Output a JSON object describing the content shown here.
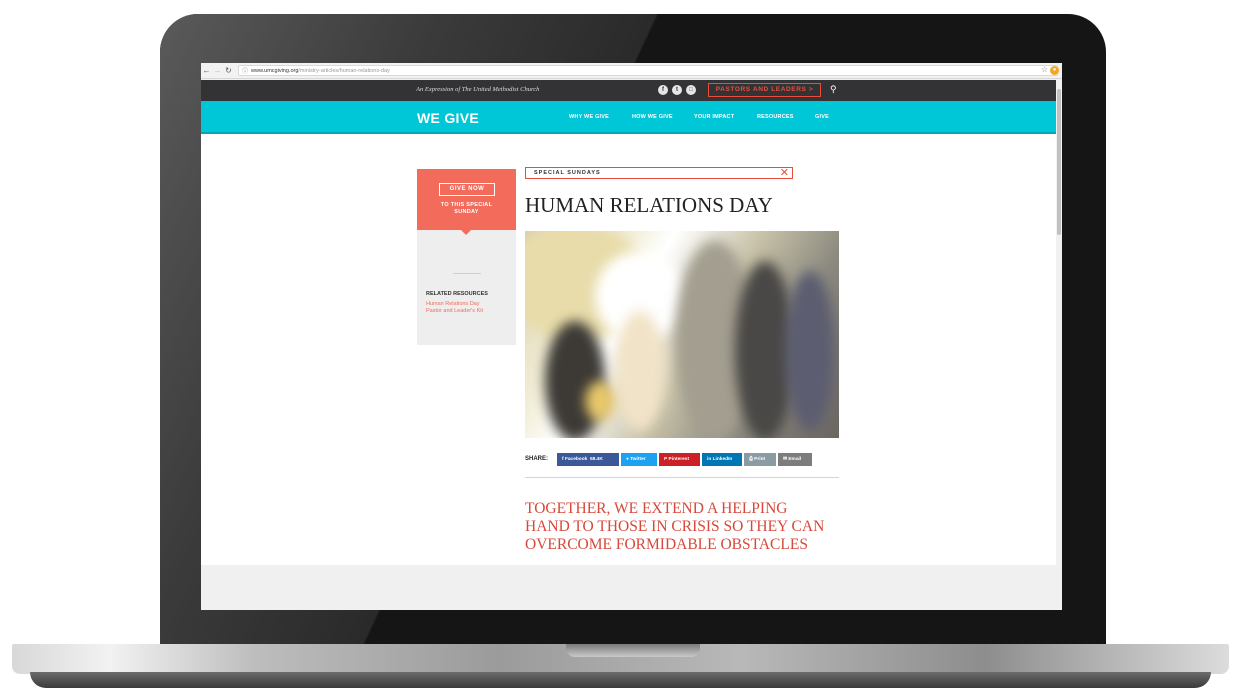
{
  "browser": {
    "url_host": "www.umcgiving.org",
    "url_path": "/ministry-articles/human-relations-day"
  },
  "topbar": {
    "tagline": "An Expression of The United Methodist Church",
    "pastors_button": "PASTORS AND LEADERS >",
    "social_icons": [
      "facebook-icon",
      "twitter-icon",
      "instagram-icon"
    ]
  },
  "nav": {
    "logo": "WE GIVE",
    "items": [
      "WHY WE GIVE",
      "HOW WE GIVE",
      "YOUR IMPACT",
      "RESOURCES",
      "GIVE"
    ]
  },
  "sidebar": {
    "give_now": "GIVE NOW",
    "give_sub_line1": "TO THIS SPECIAL",
    "give_sub_line2": "SUNDAY",
    "related_title": "RELATED RESOURCES",
    "related_link_line1": "Human Relations Day",
    "related_link_line2": "Pastor and Leader's Kit"
  },
  "article": {
    "category": "SPECIAL SUNDAYS",
    "title": "HUMAN RELATIONS DAY",
    "share_label": "SHARE:",
    "share_buttons": [
      {
        "label": "Facebook",
        "count": "58.4K",
        "color": "#3b5998"
      },
      {
        "label": "Twitter",
        "color": "#1da1f2"
      },
      {
        "label": "Pinterest",
        "color": "#cb2027"
      },
      {
        "label": "LinkedIn",
        "color": "#0077b5"
      },
      {
        "label": "Print",
        "color": "#8a9ba3"
      },
      {
        "label": "Email",
        "color": "#7d7d7d"
      }
    ],
    "intro": "TOGETHER, WE EXTEND A HELPING HAND TO THOSE IN CRISIS SO THEY CAN OVERCOME FORMIDABLE OBSTACLES"
  },
  "colors": {
    "accent_red": "#f26b5b",
    "teal": "#00c7d8",
    "dark_bar": "#333335"
  }
}
